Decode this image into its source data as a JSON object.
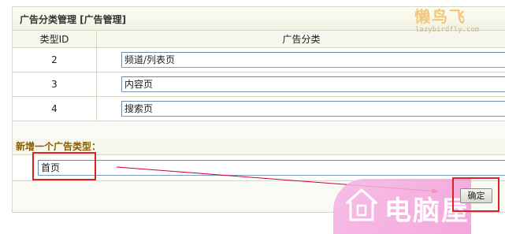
{
  "panel": {
    "title": "广告分类管理 [广告管理]",
    "logo_text": "懒鸟飞",
    "logo_url": "lazybirdfly.com"
  },
  "table": {
    "headers": {
      "id": "类型ID",
      "name": "广告分类"
    },
    "rows": [
      {
        "id": "2",
        "name": "频道/列表页"
      },
      {
        "id": "3",
        "name": "内容页"
      },
      {
        "id": "4",
        "name": "搜索页"
      }
    ]
  },
  "new_type": {
    "label": "新增一个广告类型：",
    "value": "首页"
  },
  "actions": {
    "confirm_label": "确定"
  },
  "watermark": {
    "text": "电脑屋"
  },
  "colors": {
    "panel_bg": "#fbfbf6",
    "border": "#d7d7c3",
    "label_text": "#8a5b00",
    "highlight_red": "#dd2222",
    "watermark_pink": "#f39bd9"
  }
}
